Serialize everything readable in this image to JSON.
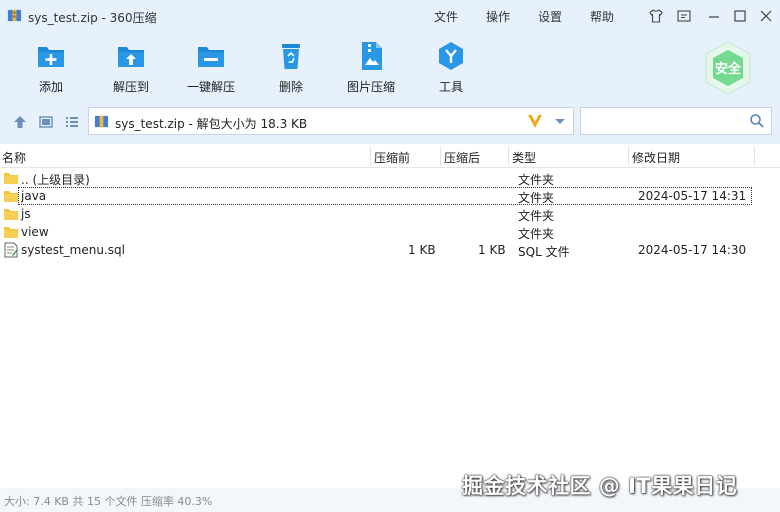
{
  "window": {
    "title": "sys_test.zip - 360压缩",
    "menu": [
      "文件",
      "操作",
      "设置",
      "帮助"
    ]
  },
  "toolbar": {
    "items": [
      {
        "label": "添加",
        "icon": "add-icon"
      },
      {
        "label": "解压到",
        "icon": "extract-to-icon"
      },
      {
        "label": "一键解压",
        "icon": "one-click-extract-icon"
      },
      {
        "label": "删除",
        "icon": "delete-icon"
      },
      {
        "label": "图片压缩",
        "icon": "image-compress-icon"
      },
      {
        "label": "工具",
        "icon": "tools-icon"
      }
    ],
    "secure_label": "安全"
  },
  "address": {
    "path": "sys_test.zip - 解包大小为 18.3 KB",
    "search_placeholder": ""
  },
  "columns": [
    "名称",
    "压缩前",
    "压缩后",
    "类型",
    "修改日期"
  ],
  "files": [
    {
      "name": ".. (上级目录)",
      "before": "",
      "after": "",
      "type": "文件夹",
      "date": "",
      "icon": "folder-icon"
    },
    {
      "name": "java",
      "before": "",
      "after": "",
      "type": "文件夹",
      "date": "2024-05-17 14:31",
      "icon": "folder-icon"
    },
    {
      "name": "js",
      "before": "",
      "after": "",
      "type": "文件夹",
      "date": "",
      "icon": "folder-icon"
    },
    {
      "name": "view",
      "before": "",
      "after": "",
      "type": "文件夹",
      "date": "",
      "icon": "folder-icon"
    },
    {
      "name": "systest_menu.sql",
      "before": "1 KB",
      "after": "1 KB",
      "type": "SQL 文件",
      "date": "2024-05-17 14:30",
      "icon": "sql-file-icon"
    }
  ],
  "status": "大小: 7.4 KB 共 15 个文件 压缩率 40.3%",
  "watermark": "掘金技术社区 @ IT果果日记",
  "colors": {
    "chrome": "#e6f1fc",
    "accent": "#1e88d8",
    "folder": "#f5c342",
    "secure": "#6fd98b"
  }
}
